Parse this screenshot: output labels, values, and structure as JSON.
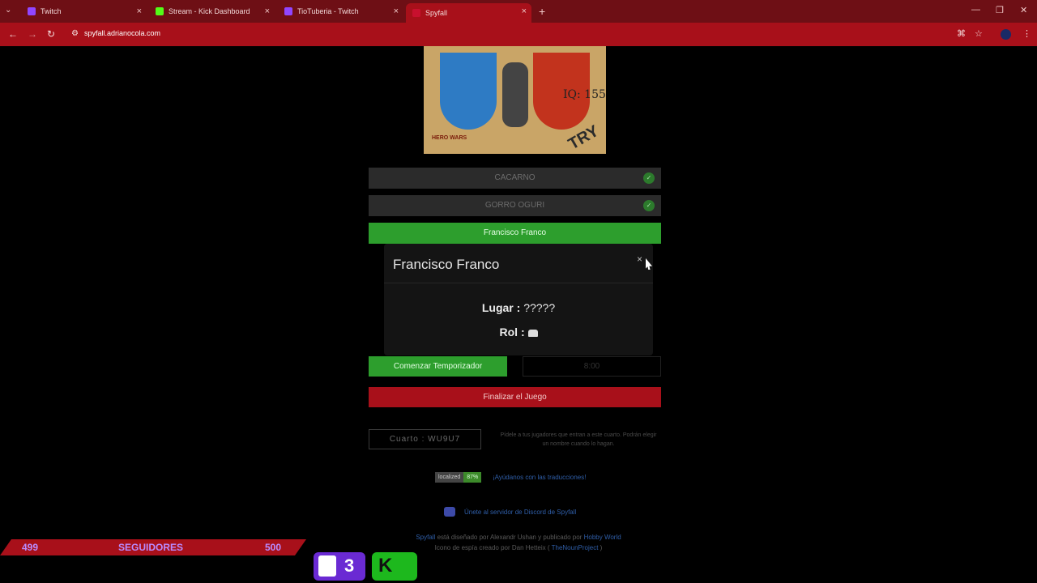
{
  "browser": {
    "tabs": [
      {
        "label": "Twitch",
        "favicon_color": "#9146ff"
      },
      {
        "label": "Stream - Kick Dashboard",
        "favicon_color": "#53fc18"
      },
      {
        "label": "TioTuberia - Twitch",
        "favicon_color": "#9146ff"
      },
      {
        "label": "Spyfall",
        "favicon_color": "#c8102e"
      }
    ],
    "url": "spyfall.adrianocola.com"
  },
  "banner": {
    "iq_text": "IQ: 155",
    "try_text": "TRY",
    "logo_text": "HERO WARS"
  },
  "players": [
    {
      "name": "CACARNO",
      "checked": true
    },
    {
      "name": "GORRO OGURI",
      "checked": true
    },
    {
      "name": "Francisco Franco",
      "checked": false
    }
  ],
  "modal": {
    "title": "Francisco Franco",
    "close": "×",
    "place_label": "Lugar :",
    "place_value": "?????",
    "role_label": "Rol :",
    "role_icon": "spy-icon"
  },
  "timer": {
    "start_label": "Comenzar Temporizador",
    "time": "8:00"
  },
  "end_game_label": "Finalizar el Juego",
  "room": {
    "label": "Cuarto : WU9U7",
    "hint": "Pídele a tus jugadores que entran a este cuarto. Podrán elegir un nombre cuando lo hagan."
  },
  "localized": {
    "badge": "localized",
    "percent": "87%",
    "link": "¡Ayúdanos con las traducciones!"
  },
  "discord": {
    "link": "Únete al servidor de Discord de Spyfall"
  },
  "credits": {
    "line1_link": "Spyfall",
    "line1_text": "está diseñado por Alexandr Ushan y publicado por",
    "line1_link2": "Hobby World",
    "line2_text": "Icono de espía creado por Dan Hetteix (",
    "line2_link": "TheNounProject",
    "line2_end": ")"
  },
  "overlay": {
    "current": "499",
    "label": "SEGUIDORES",
    "goal": "500",
    "twitch_count": "3"
  }
}
